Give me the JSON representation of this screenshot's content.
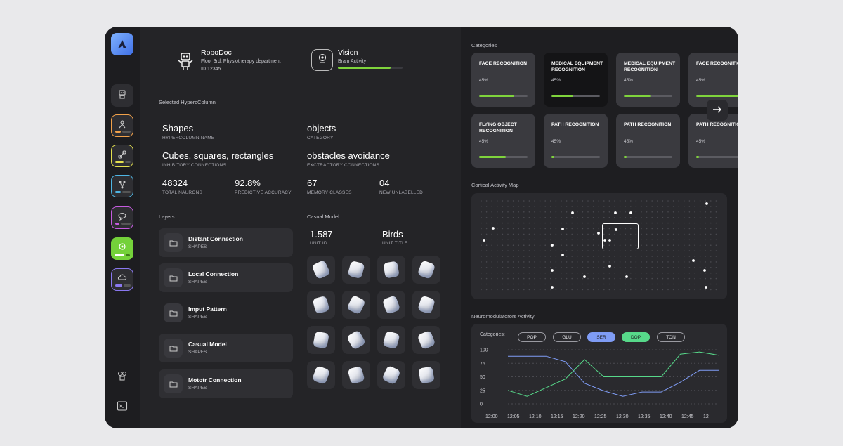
{
  "device": {
    "name": "RoboDoc",
    "location": "Floor 3rd, Physiotherapy department",
    "id": "ID 12345"
  },
  "vision": {
    "title": "Vision",
    "sub": "Brain Activity",
    "progress": 0.82
  },
  "selected": {
    "title": "Selected HypercColumn",
    "fields": [
      {
        "value": "Shapes",
        "caption": "HYPERCOLUMN NAME"
      },
      {
        "value": "objects",
        "caption": "CATEGORY"
      },
      {
        "value": "Cubes, squares, rectangles",
        "caption": "INHIBITORY CONNECTIONS"
      },
      {
        "value": "obstacles avoidance",
        "caption": "EXCTRACTORY CONNECTIONS"
      },
      {
        "value": "48324",
        "caption": "TOTAL NAURONS"
      },
      {
        "value": "92.8%",
        "caption": "PREDICTIVE ACCURACY"
      },
      {
        "value": "67",
        "caption": "MEMORY CLASSES"
      },
      {
        "value": "04",
        "caption": "NEW UNLABELLED"
      }
    ]
  },
  "layers": {
    "title": "Layers",
    "items": [
      {
        "name": "Distant Connection",
        "sub": "SHAPES"
      },
      {
        "name": "Local Connection",
        "sub": "SHAPES"
      },
      {
        "name": "Imput Pattern",
        "sub": "SHAPES"
      },
      {
        "name": "Casual Model",
        "sub": "SHAPES"
      },
      {
        "name": "Mototr Connection",
        "sub": "SHAPES"
      }
    ]
  },
  "casual": {
    "title": "Casual Model",
    "unit_id": "1.587",
    "unit_id_caption": "UNIT ID",
    "unit_title": "Birds",
    "unit_title_caption": "UNIT TITLE"
  },
  "categories": {
    "title": "Categories",
    "cards": [
      {
        "title": "FACE RECOGNITION",
        "pct": "45%",
        "fill": 0.72
      },
      {
        "title": "MEDICAL EQUIPMENT RECOGNITION",
        "pct": "45%",
        "fill": 0.45
      },
      {
        "title": "MEDICAL EQUIPMENT RECOGNITION",
        "pct": "45%",
        "fill": 0.55
      },
      {
        "title": "FACE RECOGNITION",
        "pct": "45%",
        "fill": 0.95
      },
      {
        "title": "FLYING OBJECT RECOGNITION",
        "pct": "45%",
        "fill": 0.55
      },
      {
        "title": "PATH RECOGNITION",
        "pct": "45%",
        "fill": 0.05
      },
      {
        "title": "PATH RECOGNITION",
        "pct": "45%",
        "fill": 0.05
      },
      {
        "title": "PATH RECOGNITION",
        "pct": "45%",
        "fill": 0.05
      }
    ]
  },
  "cortical": {
    "title": "Cortical Activity Map"
  },
  "neuro": {
    "title": "Neuromodulatorors Activity",
    "filter_label": "Categories:",
    "pills": [
      {
        "label": "POP",
        "active": false,
        "color": ""
      },
      {
        "label": "GLU",
        "active": false,
        "color": ""
      },
      {
        "label": "SER",
        "active": true,
        "color": "#7f9cf5"
      },
      {
        "label": "DOP",
        "active": true,
        "color": "#57d98a"
      },
      {
        "label": "TON",
        "active": false,
        "color": ""
      }
    ]
  },
  "colors": {
    "accent_green": "#7fd43c",
    "ser": "#7f9cf5",
    "dop": "#57d98a"
  },
  "chart_data": {
    "type": "line",
    "title": "Neuromodulatorors Activity",
    "xlabel": "",
    "ylabel": "",
    "x": [
      "12:00",
      "12:05",
      "12:10",
      "12:15",
      "12:20",
      "12:25",
      "12:30",
      "12:35",
      "12:40",
      "12:45",
      "12"
    ],
    "yticks": [
      100,
      75,
      50,
      25,
      0
    ],
    "ylim": [
      0,
      100
    ],
    "series": [
      {
        "name": "SER",
        "color": "#7f9cf5",
        "values": [
          88,
          88,
          88,
          78,
          38,
          24,
          14,
          22,
          22,
          40,
          62,
          62
        ]
      },
      {
        "name": "DOP",
        "color": "#57d98a",
        "values": [
          25,
          14,
          30,
          46,
          82,
          50,
          50,
          50,
          50,
          92,
          96,
          90
        ]
      }
    ],
    "grid": true
  }
}
